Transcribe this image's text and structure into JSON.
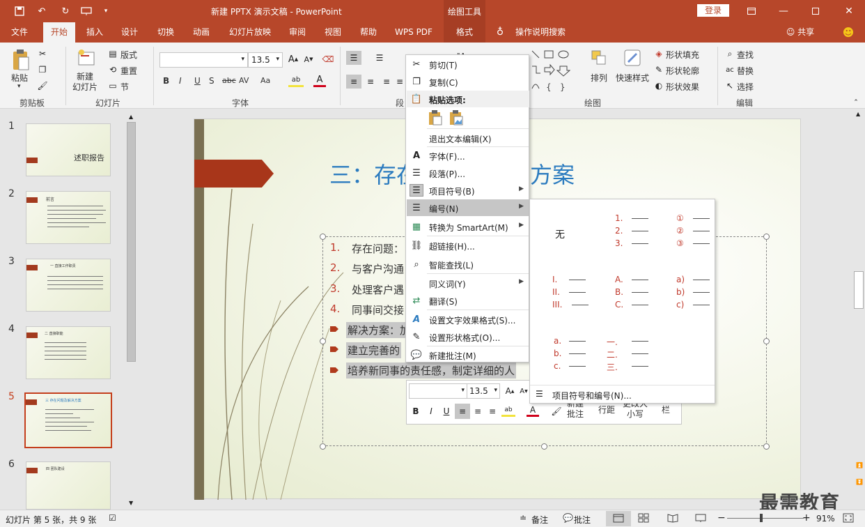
{
  "title_bar": {
    "document_title": "新建 PPTX 演示文稿 - PowerPoint",
    "context_tools": "绘图工具",
    "login": "登录"
  },
  "tabs": [
    "文件",
    "开始",
    "插入",
    "设计",
    "切换",
    "动画",
    "幻灯片放映",
    "审阅",
    "视图",
    "帮助",
    "WPS PDF",
    "格式"
  ],
  "active_tab": "开始",
  "tell_me": "操作说明搜索",
  "share": "共享",
  "ribbon": {
    "clipboard": {
      "paste": "粘贴",
      "group": "剪贴板"
    },
    "slides": {
      "new_slide": "新建\n幻灯片",
      "layout": "版式",
      "reset": "重置",
      "section": "节",
      "group": "幻灯片"
    },
    "font": {
      "size": "13.5",
      "group": "字体",
      "bold": "B",
      "italic": "I",
      "underline": "U",
      "shadow": "S",
      "strike": "abc",
      "spacing": "AV",
      "case": "Aa"
    },
    "paragraph": {
      "group": "段"
    },
    "drawing": {
      "arrange": "排列",
      "quick_styles": "快速样式",
      "fill": "形状填充",
      "outline": "形状轮廓",
      "effects": "形状效果",
      "group": "绘图"
    },
    "editing": {
      "find": "查找",
      "replace": "替换",
      "select": "选择",
      "group": "编辑"
    }
  },
  "thumbnails": [
    {
      "num": "1",
      "title": "述职报告"
    },
    {
      "num": "2",
      "title": "前言"
    },
    {
      "num": "3",
      "title": "一 直接工作职责"
    },
    {
      "num": "4",
      "title": "二 直接职能"
    },
    {
      "num": "5",
      "title": "三 存在问题及解决方案"
    },
    {
      "num": "6",
      "title": "四 团队建设"
    }
  ],
  "slide": {
    "title": "三：存在问题及解决方案",
    "numbered": [
      {
        "n": "1.",
        "text": "存在问题："
      },
      {
        "n": "2.",
        "text": "与客户沟通"
      },
      {
        "n": "3.",
        "text": "处理客户遇"
      },
      {
        "n": "4.",
        "text": "同事间交接"
      }
    ],
    "bullets": [
      "解决方案：加",
      "建立完善的",
      "培养新同事的责任感，制定详细的人"
    ]
  },
  "context_menu": {
    "cut": "剪切(T)",
    "copy": "复制(C)",
    "paste_options": "粘贴选项:",
    "exit_edit": "退出文本编辑(X)",
    "font": "字体(F)...",
    "paragraph": "段落(P)...",
    "bullets": "项目符号(B)",
    "numbering": "编号(N)",
    "smartart": "转换为 SmartArt(M)",
    "hyperlink": "超链接(H)...",
    "smart_lookup": "智能查找(L)",
    "synonyms": "同义词(Y)",
    "translate": "翻译(S)",
    "text_effects": "设置文字效果格式(S)...",
    "shape_format": "设置形状格式(O)...",
    "new_comment": "新建批注(M)"
  },
  "numbering_gallery": {
    "none": "无",
    "arabic": [
      "1.",
      "2.",
      "3."
    ],
    "circled": [
      "①",
      "②",
      "③"
    ],
    "roman": [
      "I.",
      "II.",
      "III."
    ],
    "upper_alpha": [
      "A.",
      "B.",
      "C."
    ],
    "paren_alpha": [
      "a)",
      "b)",
      "c)"
    ],
    "lower_alpha": [
      "a.",
      "b.",
      "c."
    ],
    "chinese": [
      "一.",
      "二.",
      "三."
    ],
    "more": "项目符号和编号(N)..."
  },
  "mini_toolbar": {
    "size": "13.5",
    "new_comment": "新建\n批注",
    "line_spacing": "行距",
    "case": "更改大\n小写",
    "columns": "栏"
  },
  "status_bar": {
    "slide_info": "幻灯片 第 5 张，共 9 张",
    "notes": "备注",
    "comments": "批注",
    "zoom": "91%"
  },
  "watermark": "最需教育",
  "colors": {
    "accent": "#b7472a",
    "title_blue": "#2b7bbf",
    "number_red": "#c0392b"
  }
}
